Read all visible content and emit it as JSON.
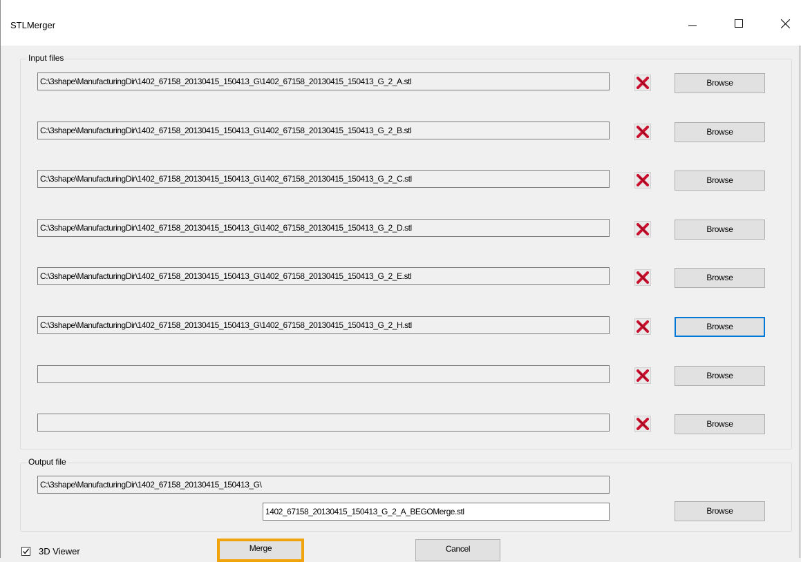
{
  "window": {
    "title": "STLMerger"
  },
  "title_controls": {
    "minimize": "—",
    "maximize": "☐",
    "close": "✕"
  },
  "input_group": {
    "legend": "Input files",
    "rows": [
      {
        "path": "C:\\3shape\\ManufacturingDir\\1402_67158_20130415_150413_G\\1402_67158_20130415_150413_G_2_A.stl",
        "browse": "Browse"
      },
      {
        "path": "C:\\3shape\\ManufacturingDir\\1402_67158_20130415_150413_G\\1402_67158_20130415_150413_G_2_B.stl",
        "browse": "Browse"
      },
      {
        "path": "C:\\3shape\\ManufacturingDir\\1402_67158_20130415_150413_G\\1402_67158_20130415_150413_G_2_C.stl",
        "browse": "Browse"
      },
      {
        "path": "C:\\3shape\\ManufacturingDir\\1402_67158_20130415_150413_G\\1402_67158_20130415_150413_G_2_D.stl",
        "browse": "Browse"
      },
      {
        "path": "C:\\3shape\\ManufacturingDir\\1402_67158_20130415_150413_G\\1402_67158_20130415_150413_G_2_E.stl",
        "browse": "Browse"
      },
      {
        "path": "C:\\3shape\\ManufacturingDir\\1402_67158_20130415_150413_G\\1402_67158_20130415_150413_G_2_H.stl",
        "browse": "Browse"
      },
      {
        "path": "",
        "browse": "Browse"
      },
      {
        "path": "",
        "browse": "Browse"
      }
    ]
  },
  "output_group": {
    "legend": "Output file",
    "directory": "C:\\3shape\\ManufacturingDir\\1402_67158_20130415_150413_G\\",
    "filename": "1402_67158_20130415_150413_G_2_A_BEGOMerge.stl",
    "browse": "Browse"
  },
  "footer": {
    "viewer_label": "3D Viewer",
    "viewer_checked": true,
    "merge_label": "Merge",
    "cancel_label": "Cancel"
  },
  "colors": {
    "delete_x": "#c8102e",
    "focus": "#0078d7",
    "default_button": "#f0a30a"
  }
}
